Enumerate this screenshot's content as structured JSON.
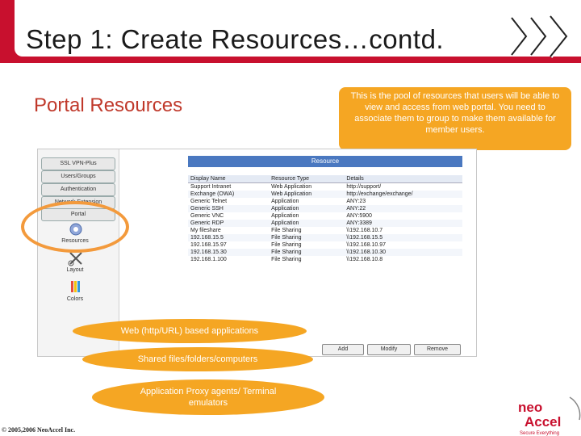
{
  "slide": {
    "title": "Step 1: Create Resources…contd.",
    "section_title": "Portal Resources",
    "callout": "This is the pool of resources that users will be able to view and access from web portal. You need to associate them to group to make them available for member users.",
    "ovals": [
      "Web (http/URL) based applications",
      "Shared files/folders/computers",
      "Application Proxy agents/ Terminal emulators"
    ],
    "copyright": "© 2005,2006 NeoAccel Inc.",
    "logo": {
      "line1": "neo",
      "line2": "Accel",
      "tagline": "Secure Everything"
    }
  },
  "app": {
    "sidebar": {
      "buttons": [
        "SSL VPN-Plus",
        "Users/Groups",
        "Authentication",
        "Network Extension",
        "Portal"
      ],
      "icons": [
        {
          "name": "resources-icon",
          "label": "Resources"
        },
        {
          "name": "layout-icon",
          "label": "Layout"
        },
        {
          "name": "colors-icon",
          "label": "Colors"
        }
      ]
    },
    "resource_header": "Resource",
    "columns": [
      "Display Name",
      "Resource Type",
      "Details"
    ],
    "rows": [
      [
        "Support Intranet",
        "Web Application",
        "http://support/"
      ],
      [
        "Exchange (OWA)",
        "Web Application",
        "http://exchange/exchange/"
      ],
      [
        "Generic Telnet",
        "Application",
        "ANY:23"
      ],
      [
        "Generic SSH",
        "Application",
        "ANY:22"
      ],
      [
        "Generic VNC",
        "Application",
        "ANY:5900"
      ],
      [
        "Generic RDP",
        "Application",
        "ANY:3389"
      ],
      [
        "My fileshare",
        "File Sharing",
        "\\\\192.168.10.7"
      ],
      [
        "192.168.15.5",
        "File Sharing",
        "\\\\192.168.15.5"
      ],
      [
        "192.168.15.97",
        "File Sharing",
        "\\\\192.168.10.97"
      ],
      [
        "192.168.15.30",
        "File Sharing",
        "\\\\192.168.10.30"
      ],
      [
        "192.168.1.100",
        "File Sharing",
        "\\\\192.168.10.8"
      ]
    ],
    "buttons": {
      "add": "Add",
      "modify": "Modify",
      "remove": "Remove"
    }
  },
  "colors": {
    "brand_red": "#c8102e",
    "accent_orange": "#f5a623",
    "header_blue": "#4a78c0"
  }
}
